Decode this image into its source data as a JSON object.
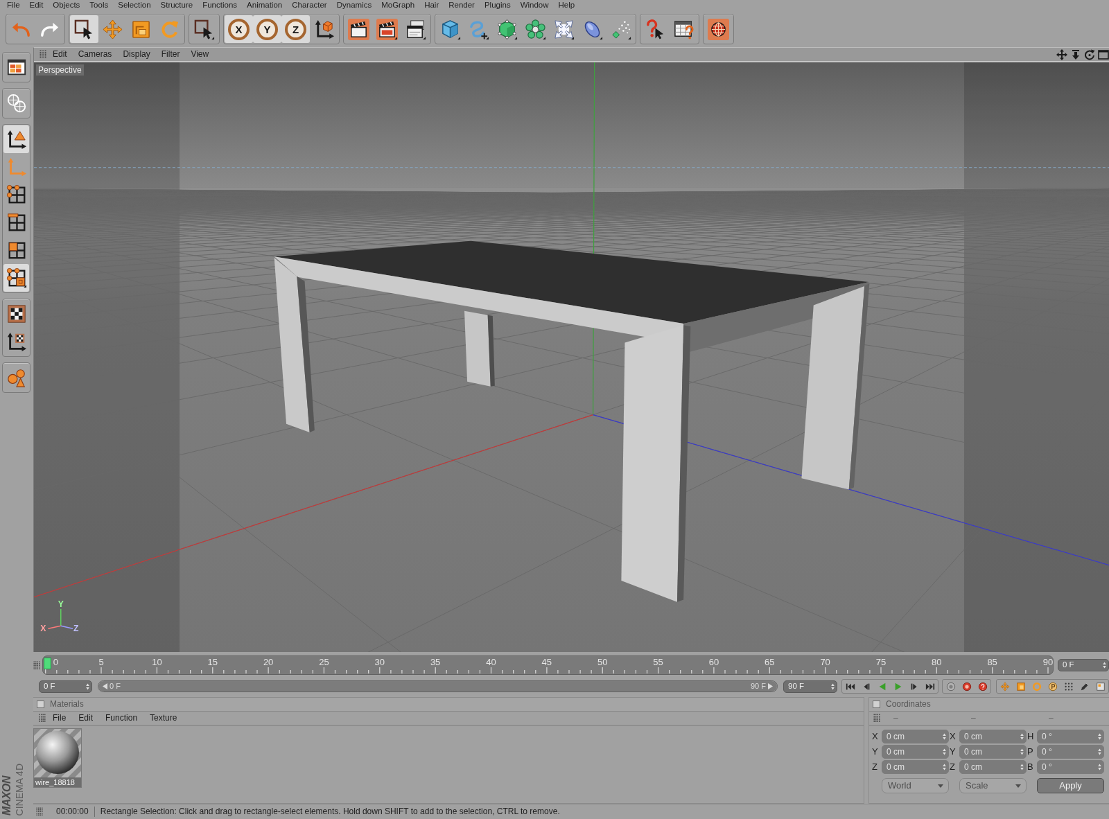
{
  "menu_bar": [
    "File",
    "Edit",
    "Objects",
    "Tools",
    "Selection",
    "Structure",
    "Functions",
    "Animation",
    "Character",
    "Dynamics",
    "MoGraph",
    "Hair",
    "Render",
    "Plugins",
    "Window",
    "Help"
  ],
  "toolbar": [
    {
      "items": [
        {
          "selected": false,
          "disabled": false
        },
        {
          "selected": false,
          "disabled": true
        }
      ]
    },
    {
      "items": [
        {
          "selected": true,
          "disabled": false
        },
        {
          "selected": false,
          "disabled": false
        },
        {
          "selected": false,
          "disabled": false
        },
        {
          "selected": false,
          "disabled": false
        }
      ]
    },
    {
      "items": [
        {
          "selected": false,
          "disabled": false
        }
      ]
    },
    {
      "items": [
        {
          "label": "X",
          "selected": true,
          "disabled": false
        },
        {
          "label": "Y",
          "selected": true,
          "disabled": false
        },
        {
          "label": "Z",
          "selected": true,
          "disabled": false
        },
        {
          "selected": false,
          "disabled": false
        }
      ]
    },
    {
      "items": [
        {
          "selected": false,
          "disabled": false
        },
        {
          "selected": false,
          "disabled": false
        },
        {
          "selected": false,
          "disabled": false
        }
      ]
    },
    {
      "items": [
        {
          "selected": false,
          "disabled": false
        },
        {
          "selected": false,
          "disabled": false
        },
        {
          "selected": false,
          "disabled": false
        },
        {
          "selected": false,
          "disabled": false
        },
        {
          "selected": false,
          "disabled": false
        },
        {
          "selected": false,
          "disabled": false
        },
        {
          "selected": false,
          "disabled": false
        }
      ]
    },
    {
      "items": [
        {
          "selected": false,
          "disabled": false
        },
        {
          "selected": false,
          "disabled": false
        }
      ]
    },
    {
      "items": [
        {
          "selected": false,
          "disabled": false
        }
      ]
    }
  ],
  "side_toolbar": [
    {
      "items": [
        {
          "selected": false,
          "disabled": false
        }
      ]
    },
    {
      "items": [
        {
          "selected": false,
          "disabled": true
        }
      ]
    },
    {
      "items": [
        {
          "selected": true,
          "disabled": false
        },
        {
          "selected": false,
          "disabled": false
        },
        {
          "selected": false,
          "disabled": false
        },
        {
          "selected": false,
          "disabled": false
        },
        {
          "selected": false,
          "disabled": false
        },
        {
          "selected": true,
          "disabled": false
        }
      ]
    },
    {
      "items": [
        {
          "selected": false,
          "disabled": false
        },
        {
          "selected": false,
          "disabled": false
        }
      ]
    },
    {
      "items": [
        {
          "selected": false,
          "disabled": false
        }
      ]
    }
  ],
  "viewport": {
    "menu": [
      "Edit",
      "Cameras",
      "Display",
      "Filter",
      "View"
    ],
    "camera_label": "Perspective",
    "axis_gizmo": {
      "x": "X",
      "y": "Y",
      "z": "Z"
    }
  },
  "timeline": {
    "ticks": [
      "0",
      "5",
      "10",
      "15",
      "20",
      "25",
      "30",
      "35",
      "40",
      "45",
      "50",
      "55",
      "60",
      "65",
      "70",
      "75",
      "80",
      "85",
      "90"
    ],
    "playhead": {
      "level": 0
    },
    "frame_field": "0 F"
  },
  "transport": {
    "start_field": "0 F",
    "range_start": "0 F",
    "range_end": "90 F",
    "level": 1,
    "end_field": "90 F"
  },
  "materials": {
    "title": "Materials",
    "menu": [
      "File",
      "Edit",
      "Function",
      "Texture"
    ],
    "items": [
      {
        "name": "wire_18818"
      }
    ]
  },
  "coordinates": {
    "title": "Coordinates",
    "headers": [
      "–",
      "–",
      "–"
    ],
    "disabled": true,
    "rows": [
      [
        {
          "label": "X",
          "value": "0 cm"
        },
        {
          "label": "X",
          "value": "0 cm"
        },
        {
          "label": "H",
          "value": "0 °"
        }
      ],
      [
        {
          "label": "Y",
          "value": "0 cm"
        },
        {
          "label": "Y",
          "value": "0 cm"
        },
        {
          "label": "P",
          "value": "0 °"
        }
      ],
      [
        {
          "label": "Z",
          "value": "0 cm"
        },
        {
          "label": "Z",
          "value": "0 cm"
        },
        {
          "label": "B",
          "value": "0 °"
        }
      ]
    ],
    "dropdowns": [
      "World",
      "Scale"
    ],
    "apply": "Apply"
  },
  "status_bar": {
    "time": "00:00:00",
    "message": "Rectangle Selection: Click and drag to rectangle-select elements. Hold down SHIFT to add to the selection, CTRL to remove."
  },
  "logo": {
    "brand": "MAXON",
    "product": "CINEMA 4D"
  }
}
